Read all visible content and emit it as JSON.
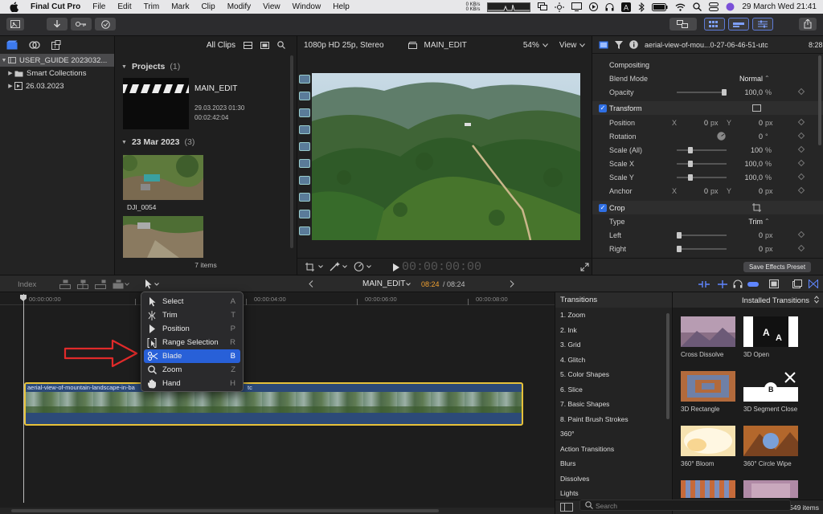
{
  "menubar": {
    "app_name": "Final Cut Pro",
    "menus": [
      "File",
      "Edit",
      "Trim",
      "Mark",
      "Clip",
      "Modify",
      "View",
      "Window",
      "Help"
    ],
    "net_up": "0 KB/s",
    "net_down": "0 KB/s",
    "datetime": "29 March Wed  21:41"
  },
  "libraries": {
    "items": [
      {
        "label": "USER_GUIDE 2023032...",
        "expanded": true
      },
      {
        "label": "Smart Collections",
        "expanded": false
      },
      {
        "label": "26.03.2023",
        "expanded": false
      }
    ]
  },
  "browser": {
    "filter_label": "All Clips",
    "projects_title": "Projects",
    "projects_count": "(1)",
    "project": {
      "name": "MAIN_EDIT",
      "date": "29.03.2023 01:30",
      "duration": "00:02:42:04"
    },
    "event_title": "23 Mar 2023",
    "event_count": "(3)",
    "clips": [
      {
        "name": "DJI_0054"
      },
      {
        "name": ""
      }
    ],
    "items_count": "7 items"
  },
  "viewer": {
    "format": "1080p HD 25p, Stereo",
    "project_name": "MAIN_EDIT",
    "zoom": "54%",
    "view_label": "View",
    "timecode": "00:00:00:00"
  },
  "inspector": {
    "clip_name": "aerial-view-of-mou...0-27-06-46-51-utc",
    "clip_duration": "8:28",
    "compositing_title": "Compositing",
    "blend_mode_label": "Blend Mode",
    "blend_mode_value": "Normal",
    "opacity_label": "Opacity",
    "opacity_value": "100,0",
    "opacity_unit": "%",
    "transform_title": "Transform",
    "position_label": "Position",
    "position_x_label": "X",
    "position_x": "0",
    "position_y_label": "Y",
    "position_y": "0",
    "px_unit": "px",
    "rotation_label": "Rotation",
    "rotation_value": "0",
    "rotation_unit": "°",
    "scale_all_label": "Scale (All)",
    "scale_all_value": "100",
    "scale_x_label": "Scale X",
    "scale_x_value": "100,0",
    "scale_y_label": "Scale Y",
    "scale_y_value": "100,0",
    "anchor_label": "Anchor",
    "anchor_x": "0",
    "anchor_y": "0",
    "crop_title": "Crop",
    "type_label": "Type",
    "type_value": "Trim",
    "left_label": "Left",
    "left_value": "0",
    "right_label": "Right",
    "right_value": "0",
    "save_preset_label": "Save Effects Preset"
  },
  "timeline": {
    "index_label": "Index",
    "project_name": "MAIN_EDIT",
    "timecode_current": "08:24",
    "timecode_total": "/ 08:24",
    "ruler_labels": [
      "00:00:00:00",
      "00:00:04:00",
      "00:00:06:00",
      "00:00:08:00"
    ],
    "clip_label": "aerial-view-of-mountain-landscape-in-ba",
    "clip_label_tail": "tc"
  },
  "tools_menu": {
    "items": [
      {
        "label": "Select",
        "key": "A",
        "icon": "arrow-icon"
      },
      {
        "label": "Trim",
        "key": "T",
        "icon": "trim-icon"
      },
      {
        "label": "Position",
        "key": "P",
        "icon": "position-arrow-icon"
      },
      {
        "label": "Range Selection",
        "key": "R",
        "icon": "range-selection-icon"
      },
      {
        "label": "Blade",
        "key": "B",
        "icon": "scissors-icon",
        "active": true
      },
      {
        "label": "Zoom",
        "key": "Z",
        "icon": "magnifier-icon"
      },
      {
        "label": "Hand",
        "key": "H",
        "icon": "hand-icon"
      }
    ]
  },
  "transitions": {
    "title": "Transitions",
    "categories": [
      "1. Zoom",
      "2. Ink",
      "3. Grid",
      "4. Glitch",
      "5. Color Shapes",
      "6. Slice",
      "7. Basic Shapes",
      "8. Paint Brush Strokes",
      "360°",
      "Action Transitions",
      "Blurs",
      "Dissolves",
      "Lights"
    ],
    "installed_title": "Installed Transitions",
    "tiles": [
      "Cross Dissolve",
      "3D Open",
      "3D Rectangle",
      "3D Segment Close",
      "360° Bloom",
      "360° Circle Wipe"
    ],
    "search_placeholder": "Search",
    "items_count": "549 items"
  },
  "colors": {
    "accent": "#2860d8",
    "clip_border": "#e6c13a",
    "arrow": "#e02a2a",
    "timecode_orange": "#f0a030"
  }
}
